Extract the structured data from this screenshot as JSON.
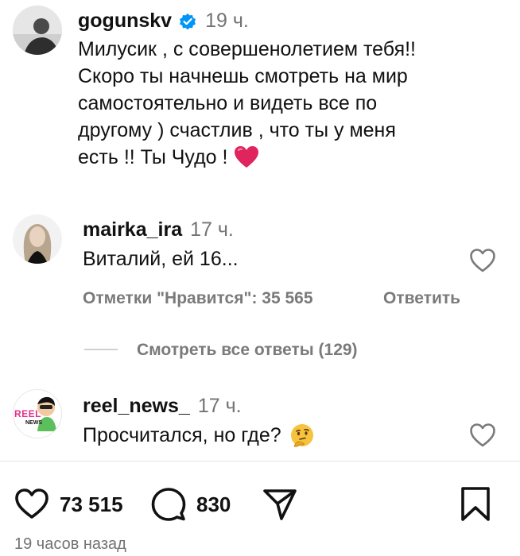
{
  "caption": {
    "username": "gogunskv",
    "time": "19 ч.",
    "lines": [
      "Милусик , с совершенолетием тебя!!",
      "Скоро ты начнешь смотреть на мир",
      "самостоятельно и видеть все по",
      "другому ) счастлив , что ты у меня",
      "есть !! Ты Чудо !"
    ],
    "emoji": "heart"
  },
  "comments": [
    {
      "username": "mairka_ira",
      "time": "17 ч.",
      "text": "Виталий, ей 16...",
      "likes_label": "Отметки \"Нравится\": 35 565",
      "reply_label": "Ответить",
      "view_replies": "Смотреть все ответы (129)"
    },
    {
      "username": "reel_news_",
      "time": "17 ч.",
      "text": "Просчитался, но где?",
      "emoji": "thinking-face",
      "avatar_text_1": "REEL",
      "avatar_text_2": "NEWS"
    }
  ],
  "actions": {
    "likes": "73 515",
    "comments": "830"
  },
  "timestamp": "19 часов назад",
  "colors": {
    "verified": "#0095f6",
    "heart_emoji": "#e0245e",
    "muted": "#737373"
  }
}
